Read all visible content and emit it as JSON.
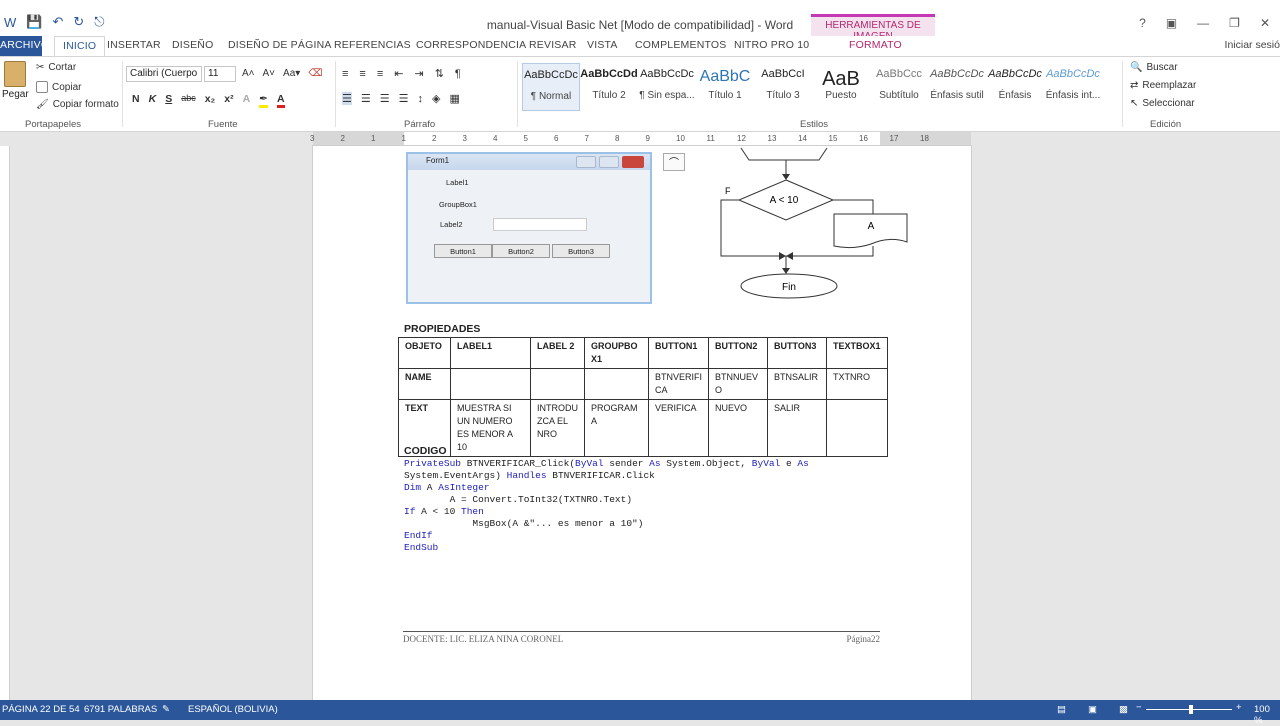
{
  "window": {
    "title": "manual-Visual Basic Net [Modo de compatibilidad] - Word",
    "context_tab_group": "HERRAMIENTAS DE IMAGEN",
    "context_tab": "FORMATO",
    "sign_in": "Iniciar sesió"
  },
  "tabs": [
    "ARCHIVO",
    "INICIO",
    "INSERTAR",
    "DISEÑO",
    "DISEÑO DE PÁGINA",
    "REFERENCIAS",
    "CORRESPONDENCIA",
    "REVISAR",
    "VISTA",
    "COMPLEMENTOS",
    "NITRO PRO 10"
  ],
  "clipboard": {
    "paste": "Pegar",
    "cut": "Cortar",
    "copy": "Copiar",
    "format_painter": "Copiar formato",
    "label": "Portapapeles"
  },
  "font": {
    "name": "Calibri (Cuerpo",
    "size": "11",
    "label": "Fuente",
    "buttons": [
      "N",
      "K",
      "S",
      "abc",
      "x₂",
      "x²"
    ]
  },
  "paragraph": {
    "label": "Párrafo"
  },
  "styles": {
    "label": "Estilos",
    "items": [
      {
        "sample": "AaBbCcDc",
        "name": "¶ Normal"
      },
      {
        "sample": "AaBbCcDd",
        "name": "Título 2"
      },
      {
        "sample": "AaBbCcDc",
        "name": "¶ Sin espa..."
      },
      {
        "sample": "AaBbC",
        "name": "Título 1"
      },
      {
        "sample": "AaBbCcI",
        "name": "Título 3"
      },
      {
        "sample": "AaB",
        "name": "Puesto"
      },
      {
        "sample": "AaBbCcc",
        "name": "Subtítulo"
      },
      {
        "sample": "AaBbCcDc",
        "name": "Énfasis sutil"
      },
      {
        "sample": "AaBbCcDc",
        "name": "Énfasis"
      },
      {
        "sample": "AaBbCcDc",
        "name": "Énfasis int..."
      }
    ]
  },
  "editing": {
    "label": "Edición",
    "find": "Buscar",
    "replace": "Reemplazar",
    "select": "Seleccionar"
  },
  "ruler_numbers": [
    "3",
    "2",
    "1",
    "1",
    "2",
    "3",
    "4",
    "5",
    "6",
    "7",
    "8",
    "9",
    "10",
    "11",
    "12",
    "13",
    "14",
    "15",
    "16",
    "17",
    "18"
  ],
  "form": {
    "title": "Form1",
    "label1": "Label1",
    "groupbox": "GroupBox1",
    "label2": "Label2",
    "buttons": [
      "Button1",
      "Button2",
      "Button3"
    ]
  },
  "flowchart": {
    "false_label": "F",
    "condition": "A < 10",
    "output": "A",
    "end": "Fin"
  },
  "document": {
    "properties_heading": "PROPIEDADES",
    "table": [
      [
        "OBJETO",
        "LABEL1",
        "LABEL 2",
        "GROUPBO X1",
        "BUTTON1",
        "BUTTON2",
        "BUTTON3",
        "TEXTBOX1"
      ],
      [
        "NAME",
        "",
        "",
        "",
        "BTNVERIFI CA",
        "BTNNUEV O",
        "BTNSALIR",
        "TXTNRO"
      ],
      [
        "TEXT",
        "MUESTRA SI UN NUMERO ES MENOR A 10",
        "INTRODU ZCA EL NRO",
        "PROGRAM A",
        "VERIFICA",
        "NUEVO",
        "SALIR",
        ""
      ]
    ],
    "code_heading": "CODIGO",
    "footer_left": "DOCENTE: LIC. ELIZA NINA CORONEL",
    "footer_right": "Página22"
  },
  "status": {
    "page": "PÁGINA 22 DE 54",
    "words": "6791 PALABRAS",
    "language": "ESPAÑOL (BOLIVIA)",
    "zoom": "100 %"
  },
  "colors": {
    "accent": "#2b579a",
    "context": "#c239b3",
    "keyword": "#1f1fb8"
  }
}
